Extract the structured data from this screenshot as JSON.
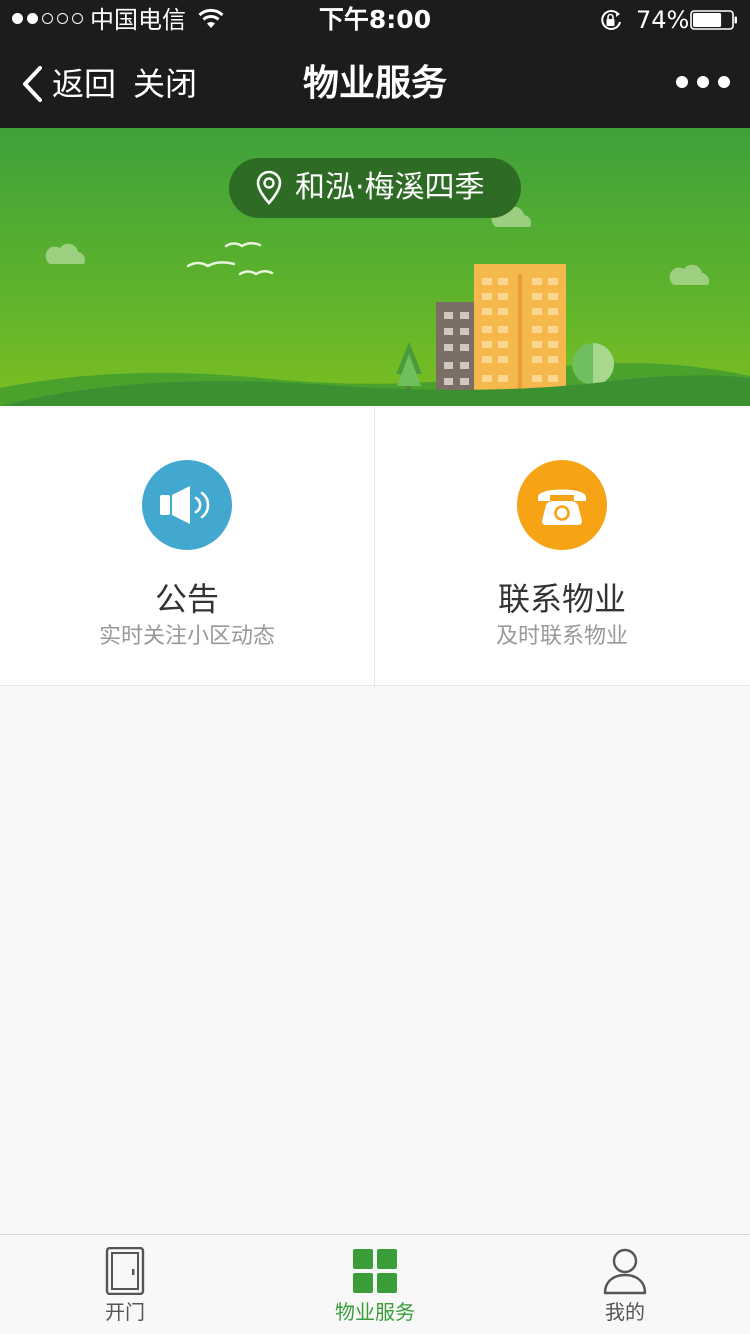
{
  "status_bar": {
    "carrier": "中国电信",
    "time": "下午8:00",
    "battery_percent": "74%",
    "battery_level": 0.74,
    "signal_strength": 2,
    "signal_max": 5
  },
  "nav": {
    "back_label": "返回",
    "close_label": "关闭",
    "title": "物业服务",
    "more_icon": "more-dots-icon"
  },
  "banner": {
    "location": "和泓·梅溪四季",
    "location_icon": "map-pin-icon"
  },
  "services": [
    {
      "title": "公告",
      "subtitle": "实时关注小区动态",
      "icon": "speaker-icon",
      "color": "#43a8d0"
    },
    {
      "title": "联系物业",
      "subtitle": "及时联系物业",
      "icon": "telephone-icon",
      "color": "#f6a316"
    }
  ],
  "tabs": [
    {
      "label": "开门",
      "icon": "door-icon",
      "active": false
    },
    {
      "label": "物业服务",
      "icon": "grid-icon",
      "active": true
    },
    {
      "label": "我的",
      "icon": "person-icon",
      "active": false
    }
  ],
  "colors": {
    "header_bg": "#1c1c1e",
    "brand_green": "#3a9d3a",
    "banner_green": "#4aa834",
    "pill_bg": "#2e6b25"
  }
}
